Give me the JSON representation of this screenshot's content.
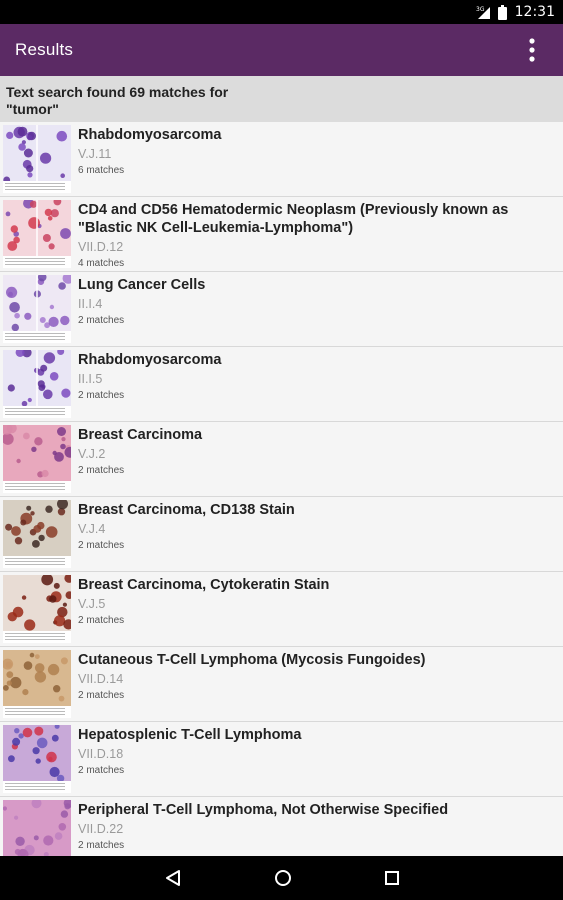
{
  "status_bar": {
    "time": "12:31",
    "network": "3G",
    "icons": [
      "signal-icon",
      "battery-icon"
    ]
  },
  "app_bar": {
    "title": "Results",
    "menu_icon": "overflow-menu-icon"
  },
  "search": {
    "line1": "Text search found 69 matches for",
    "line2": "\"tumor\""
  },
  "results": [
    {
      "title": "Rhabdomyosarcoma",
      "code": "V.J.11",
      "matches": "6 matches",
      "thumb": "purple-cells"
    },
    {
      "title": "CD4 and CD56 Hematodermic Neoplasm (Previously known as \"Blastic NK Cell-Leukemia-Lymphoma\")",
      "code": "VII.D.12",
      "matches": "4 matches",
      "thumb": "red-purple-cells"
    },
    {
      "title": "Lung Cancer Cells",
      "code": "II.I.4",
      "matches": "2 matches",
      "thumb": "pale-purple-cells"
    },
    {
      "title": "Rhabdomyosarcoma",
      "code": "II.I.5",
      "matches": "2 matches",
      "thumb": "purple-cells"
    },
    {
      "title": "Breast Carcinoma",
      "code": "V.J.2",
      "matches": "2 matches",
      "thumb": "pink-tissue"
    },
    {
      "title": "Breast Carcinoma, CD138 Stain",
      "code": "V.J.4",
      "matches": "2 matches",
      "thumb": "brown-stain"
    },
    {
      "title": "Breast Carcinoma, Cytokeratin Stain",
      "code": "V.J.5",
      "matches": "2 matches",
      "thumb": "dark-red-stain"
    },
    {
      "title": "Cutaneous T-Cell Lymphoma (Mycosis Fungoides)",
      "code": "VII.D.14",
      "matches": "2 matches",
      "thumb": "tan-tissue"
    },
    {
      "title": "Hepatosplenic T-Cell Lymphoma",
      "code": "VII.D.18",
      "matches": "2 matches",
      "thumb": "blue-red-cells"
    },
    {
      "title": "Peripheral T-Cell Lymphoma, Not Otherwise Specified",
      "code": "VII.D.22",
      "matches": "2 matches",
      "thumb": "pink-purple-tissue"
    }
  ],
  "nav_bar": {
    "buttons": [
      "back-icon",
      "home-icon",
      "recents-icon"
    ]
  },
  "colors": {
    "app_bar": "#5b2a64",
    "summary_bg": "#dcdcdc",
    "row_bg": "#f5f5f5"
  }
}
